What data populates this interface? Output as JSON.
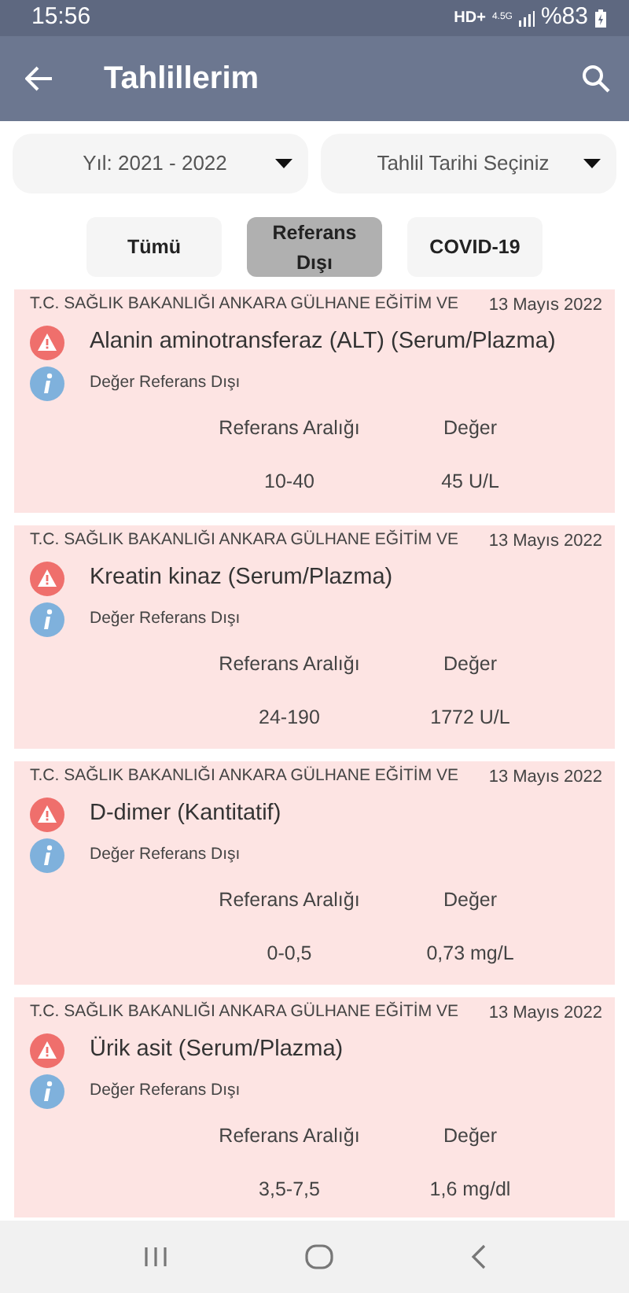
{
  "status_bar": {
    "time": "15:56",
    "network": "HD+",
    "signal_type": "4.5G",
    "battery": "%83"
  },
  "app_bar": {
    "title": "Tahlillerim"
  },
  "filters": [
    {
      "label": "Yıl: 2021 - 2022"
    },
    {
      "label": "Tahlil Tarihi Seçiniz"
    }
  ],
  "tabs": [
    {
      "label": "Tümü",
      "selected": false
    },
    {
      "label": "Referans Dışı",
      "selected": true
    },
    {
      "label": "COVID-19",
      "selected": false
    }
  ],
  "results": [
    {
      "hospital": "T.C. SAĞLIK BAKANLIĞI ANKARA GÜLHANE EĞİTİM VE",
      "date": "13 Mayıs 2022",
      "test": "Alanin aminotransferaz (ALT) (Serum/Plazma)",
      "status": "Değer Referans Dışı",
      "range_label": "Referans Aralığı",
      "value_label": "Değer",
      "range": "10-40",
      "value": "45 U/L"
    },
    {
      "hospital": "T.C. SAĞLIK BAKANLIĞI ANKARA GÜLHANE EĞİTİM VE",
      "date": "13 Mayıs 2022",
      "test": "Kreatin kinaz (Serum/Plazma)",
      "status": "Değer Referans Dışı",
      "range_label": "Referans Aralığı",
      "value_label": "Değer",
      "range": "24-190",
      "value": "1772 U/L"
    },
    {
      "hospital": "T.C. SAĞLIK BAKANLIĞI ANKARA GÜLHANE EĞİTİM VE",
      "date": "13 Mayıs 2022",
      "test": "D-dimer (Kantitatif)",
      "status": "Değer Referans Dışı",
      "range_label": "Referans Aralığı",
      "value_label": "Değer",
      "range": "0-0,5",
      "value": "0,73 mg/L"
    },
    {
      "hospital": "T.C. SAĞLIK BAKANLIĞI ANKARA GÜLHANE EĞİTİM VE",
      "date": "13 Mayıs 2022",
      "test": "Ürik asit (Serum/Plazma)",
      "status": "Değer Referans Dışı",
      "range_label": "Referans Aralığı",
      "value_label": "Değer",
      "range": "3,5-7,5",
      "value": "1,6 mg/dl"
    }
  ]
}
